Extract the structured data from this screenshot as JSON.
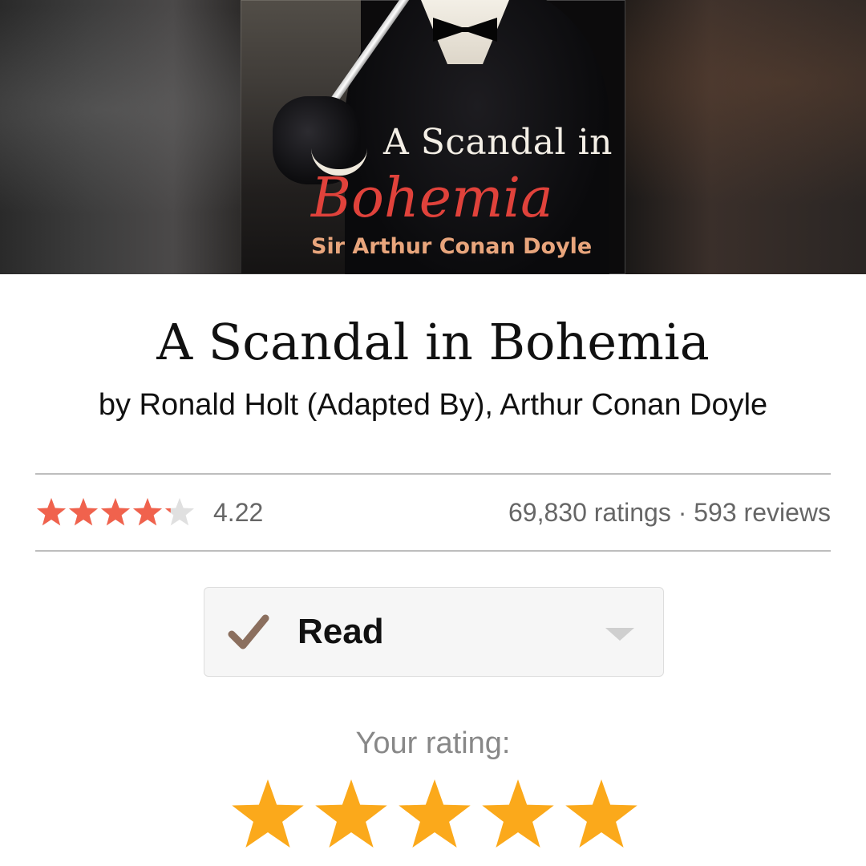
{
  "cover": {
    "title_line1": "A Scandal in",
    "title_line2": "Bohemia",
    "author_line": "Sir Arthur Conan Doyle"
  },
  "book": {
    "title": "A Scandal in Bohemia",
    "authors": "by Ronald Holt (Adapted By), Arthur Conan Doyle"
  },
  "ratings": {
    "average": "4.22",
    "average_stars_fill": 4.22,
    "counts": "69,830 ratings · 593 reviews",
    "star_color": "#f0624d",
    "star_empty_color": "#e0e0e0"
  },
  "shelf": {
    "label": "Read",
    "check_icon": "checkmark-icon",
    "check_color": "#8b6f5e"
  },
  "your_rating": {
    "label": "Your rating:",
    "stars": 5,
    "star_color": "#fba91b"
  }
}
